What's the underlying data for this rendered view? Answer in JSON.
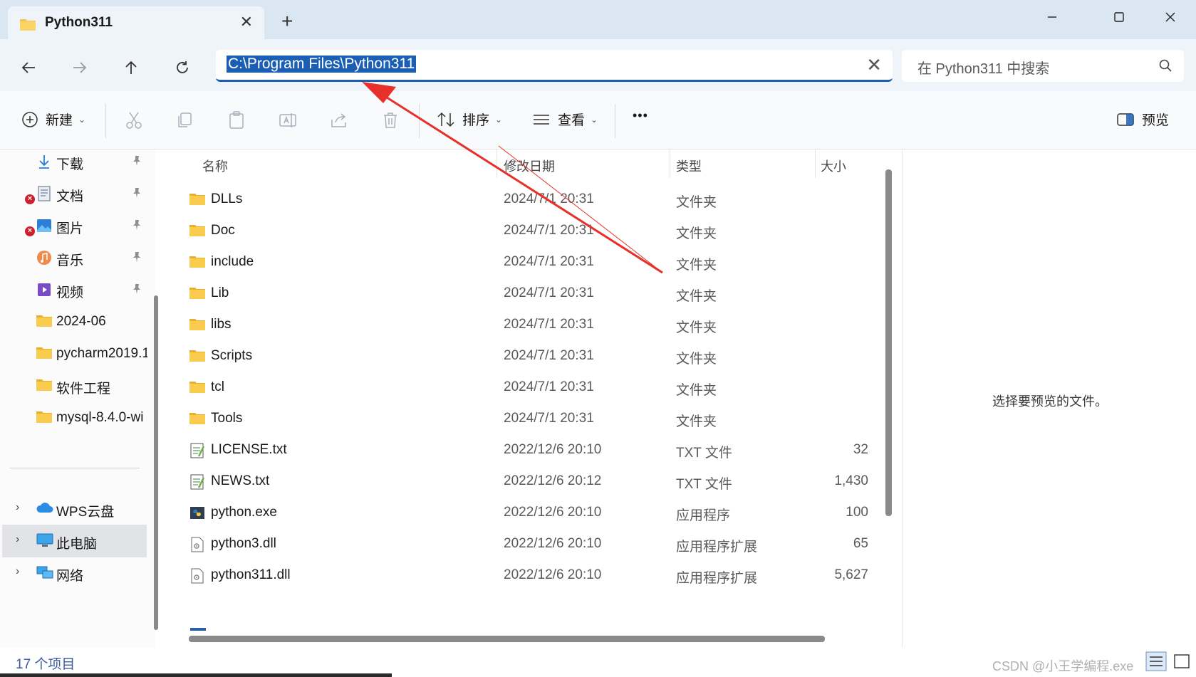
{
  "window": {
    "tab_title": "Python311",
    "tab_close": "✕",
    "new_tab": "+",
    "minimize": "minimize",
    "maximize": "maximize",
    "close": "close"
  },
  "nav": {
    "address_value": "C:\\Program Files\\Python311",
    "address_clear": "✕",
    "search_placeholder": "在 Python311 中搜索"
  },
  "toolbar": {
    "new_label": "新建",
    "sort_label": "排序",
    "view_label": "查看",
    "more_label": "•••",
    "preview_label": "预览"
  },
  "sidebar": {
    "quick_access": [
      {
        "label": "下载",
        "icon": "download-icon",
        "pinned": true,
        "error": false
      },
      {
        "label": "文档",
        "icon": "documents-icon",
        "pinned": true,
        "error": true
      },
      {
        "label": "图片",
        "icon": "pictures-icon",
        "pinned": true,
        "error": true
      },
      {
        "label": "音乐",
        "icon": "music-icon",
        "pinned": true,
        "error": false
      },
      {
        "label": "视频",
        "icon": "videos-icon",
        "pinned": true,
        "error": false
      },
      {
        "label": "2024-06",
        "icon": "folder-icon",
        "pinned": false,
        "error": false
      },
      {
        "label": "pycharm2019.1",
        "icon": "folder-icon",
        "pinned": false,
        "error": false
      },
      {
        "label": "软件工程",
        "icon": "folder-icon",
        "pinned": false,
        "error": false
      },
      {
        "label": "mysql-8.4.0-wi",
        "icon": "folder-icon",
        "pinned": false,
        "error": false
      }
    ],
    "locations": [
      {
        "label": "WPS云盘",
        "icon": "cloud-icon",
        "selected": false
      },
      {
        "label": "此电脑",
        "icon": "this-pc-icon",
        "selected": true
      },
      {
        "label": "网络",
        "icon": "network-icon",
        "selected": false
      }
    ]
  },
  "filelist": {
    "columns": {
      "name": "名称",
      "date": "修改日期",
      "type": "类型",
      "size": "大小"
    },
    "rows": [
      {
        "name": "DLLs",
        "date": "2024/7/1 20:31",
        "type": "文件夹",
        "size": "",
        "icon": "folder-icon"
      },
      {
        "name": "Doc",
        "date": "2024/7/1 20:31",
        "type": "文件夹",
        "size": "",
        "icon": "folder-icon"
      },
      {
        "name": "include",
        "date": "2024/7/1 20:31",
        "type": "文件夹",
        "size": "",
        "icon": "folder-icon"
      },
      {
        "name": "Lib",
        "date": "2024/7/1 20:31",
        "type": "文件夹",
        "size": "",
        "icon": "folder-icon"
      },
      {
        "name": "libs",
        "date": "2024/7/1 20:31",
        "type": "文件夹",
        "size": "",
        "icon": "folder-icon"
      },
      {
        "name": "Scripts",
        "date": "2024/7/1 20:31",
        "type": "文件夹",
        "size": "",
        "icon": "folder-icon"
      },
      {
        "name": "tcl",
        "date": "2024/7/1 20:31",
        "type": "文件夹",
        "size": "",
        "icon": "folder-icon"
      },
      {
        "name": "Tools",
        "date": "2024/7/1 20:31",
        "type": "文件夹",
        "size": "",
        "icon": "folder-icon"
      },
      {
        "name": "LICENSE.txt",
        "date": "2022/12/6 20:10",
        "type": "TXT 文件",
        "size": "32",
        "icon": "text-file-icon"
      },
      {
        "name": "NEWS.txt",
        "date": "2022/12/6 20:12",
        "type": "TXT 文件",
        "size": "1,430",
        "icon": "text-file-icon"
      },
      {
        "name": "python.exe",
        "date": "2022/12/6 20:10",
        "type": "应用程序",
        "size": "100",
        "icon": "python-exe-icon"
      },
      {
        "name": "python3.dll",
        "date": "2022/12/6 20:10",
        "type": "应用程序扩展",
        "size": "65",
        "icon": "dll-file-icon"
      },
      {
        "name": "python311.dll",
        "date": "2022/12/6 20:10",
        "type": "应用程序扩展",
        "size": "5,627",
        "icon": "dll-file-icon"
      }
    ]
  },
  "preview": {
    "message": "选择要预览的文件。"
  },
  "status": {
    "item_count": "17 个项目",
    "watermark": "CSDN @小王学编程.exe"
  },
  "colors": {
    "accent": "#1a5fb4",
    "folder": "#f6c344",
    "annotation_arrow": "#e8302a"
  }
}
